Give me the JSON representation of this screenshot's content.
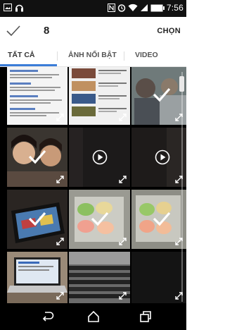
{
  "status_bar": {
    "time": "7:56",
    "left_icons": [
      "image-notification-icon",
      "headphones-icon"
    ],
    "right_icons": [
      "nfc-icon",
      "alarm-icon",
      "wifi-icon",
      "signal-icon",
      "battery-icon"
    ]
  },
  "app_bar": {
    "selection_icon": "check-icon",
    "selected_count": "8",
    "action_label": "CHỌN"
  },
  "tabs": [
    {
      "label": "TẤT CẢ",
      "active": true
    },
    {
      "label": "ẢNH NỔI BẬT",
      "active": false
    },
    {
      "label": "VIDEO",
      "active": false
    }
  ],
  "grid": {
    "tiles": [
      {
        "content": "screenshot-web-page",
        "selected": false,
        "video": false
      },
      {
        "content": "screenshot-youtube-list",
        "selected": false,
        "video": false
      },
      {
        "content": "photo-people-dim",
        "selected": true,
        "video": false
      },
      {
        "content": "selfie-two-people",
        "selected": true,
        "video": false
      },
      {
        "content": "dark-video",
        "selected": false,
        "video": true
      },
      {
        "content": "dark-video",
        "selected": false,
        "video": true
      },
      {
        "content": "tablet-screen",
        "selected": true,
        "video": false
      },
      {
        "content": "macarons",
        "selected": true,
        "video": false
      },
      {
        "content": "macarons",
        "selected": true,
        "video": false
      },
      {
        "content": "laptop-on-desk",
        "selected": false,
        "video": false
      },
      {
        "content": "keyboard-closeup",
        "selected": false,
        "video": false
      },
      {
        "content": "dark-photo",
        "selected": false,
        "video": false
      }
    ]
  },
  "nav_bar": {
    "buttons": [
      "back-icon",
      "home-icon",
      "recent-apps-icon"
    ]
  },
  "colors": {
    "accent": "#3b7dd8",
    "status_bar": "#111111",
    "nav_bar": "#000000"
  }
}
